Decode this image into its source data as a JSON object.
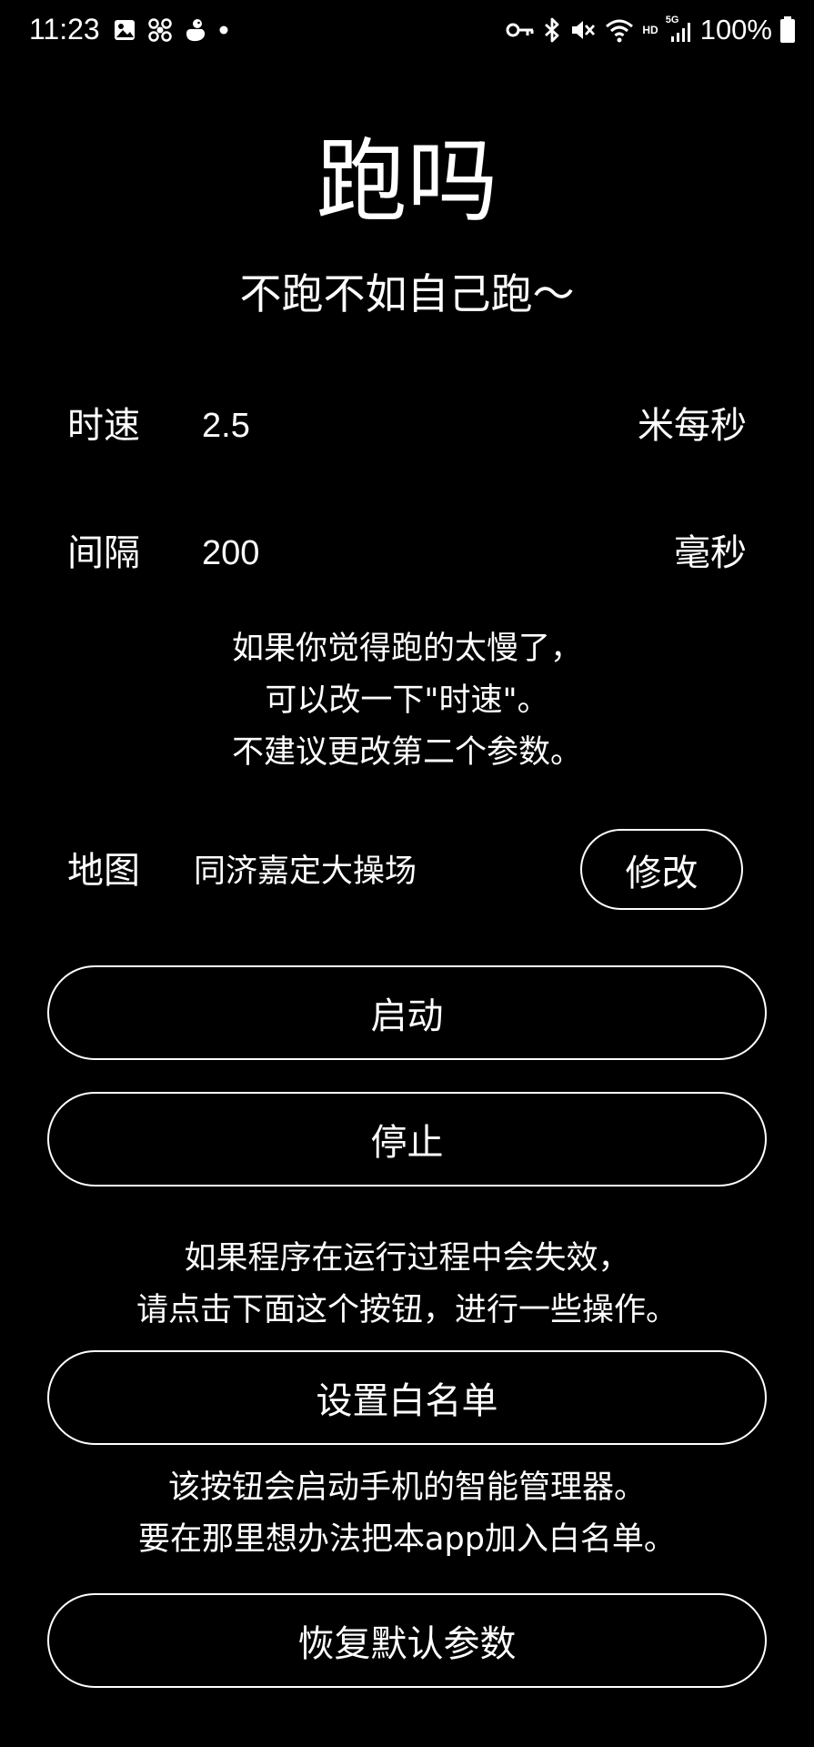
{
  "status_bar": {
    "time": "11:23",
    "hd_label": "HD",
    "network_label": "5G",
    "battery": "100%",
    "left_icons": [
      "gallery-icon",
      "pinwheel-icon",
      "duck-icon",
      "dot-icon"
    ],
    "right_icons": [
      "key-icon",
      "bluetooth-icon",
      "mute-icon",
      "wifi-icon",
      "signal-icon",
      "battery-icon"
    ]
  },
  "header": {
    "title": "跑吗",
    "subtitle": "不跑不如自己跑～"
  },
  "params": {
    "speed": {
      "label": "时速",
      "value": "2.5",
      "unit": "米每秒"
    },
    "interval": {
      "label": "间隔",
      "value": "200",
      "unit": "毫秒"
    }
  },
  "notes": {
    "speed_hint": [
      "如果你觉得跑的太慢了，",
      "可以改一下\"时速\"。",
      "不建议更改第二个参数。"
    ],
    "failure_hint": [
      "如果程序在运行过程中会失效，",
      "请点击下面这个按钮，进行一些操作。"
    ],
    "whitelist_hint": [
      "该按钮会启动手机的智能管理器。",
      "要在那里想办法把本app加入白名单。"
    ]
  },
  "map": {
    "label": "地图",
    "value": "同济嘉定大操场",
    "modify_label": "修改"
  },
  "buttons": {
    "start": "启动",
    "stop": "停止",
    "whitelist": "设置白名单",
    "reset": "恢复默认参数"
  },
  "colors": {
    "background": "#000000",
    "foreground": "#ffffff"
  }
}
